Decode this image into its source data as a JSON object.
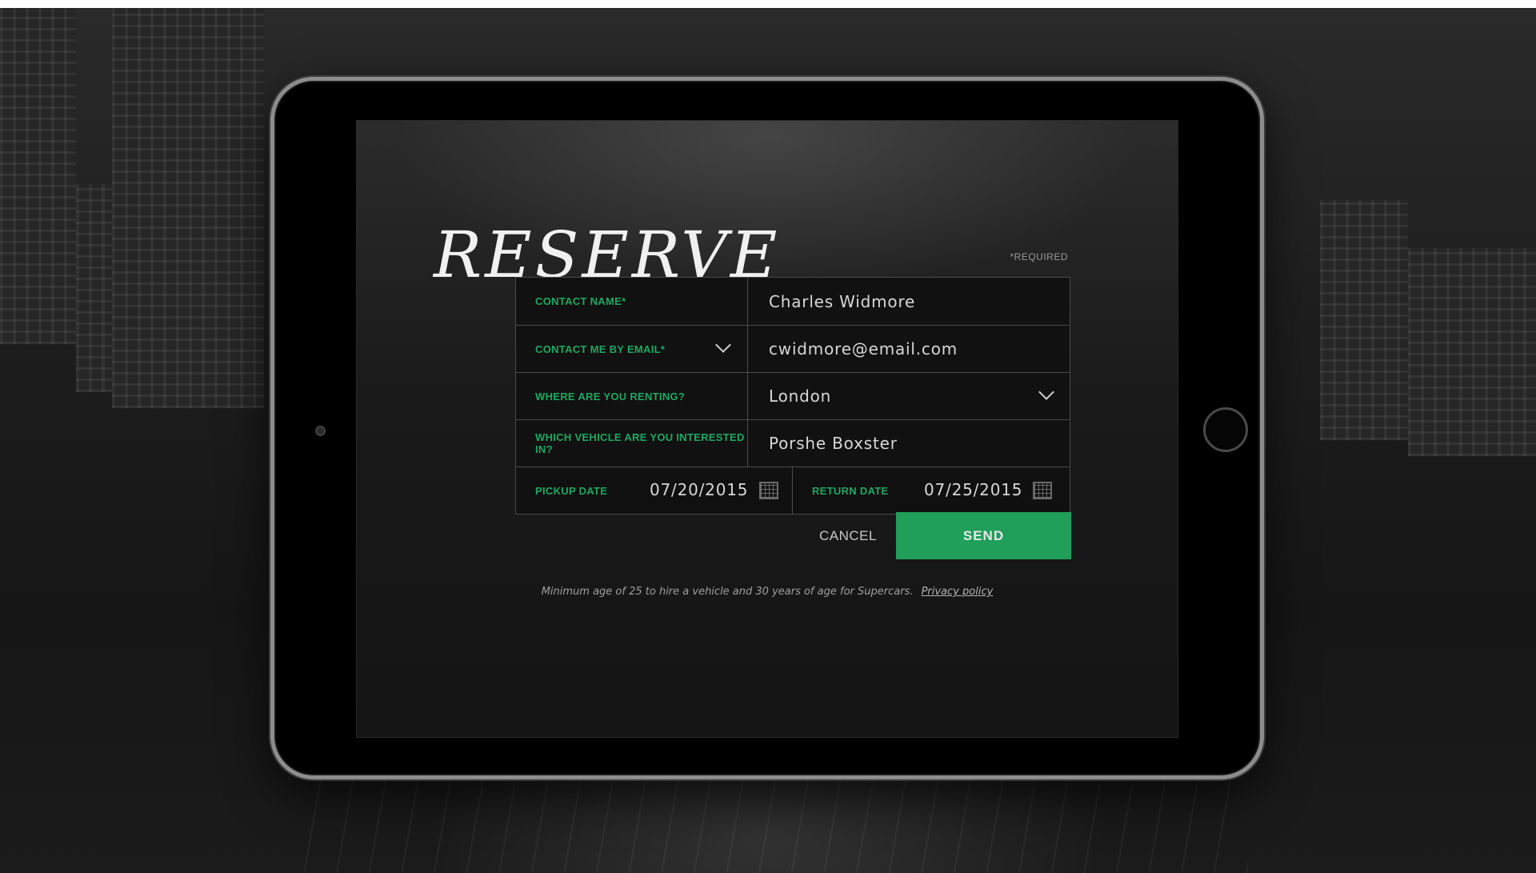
{
  "form": {
    "title": "RESERVE",
    "required_note": "*REQUIRED",
    "fields": {
      "contact_name": {
        "label": "CONTACT NAME*",
        "value": "Charles Widmore"
      },
      "contact_email": {
        "label": "CONTACT ME BY EMAIL*",
        "value": "cwidmore@email.com"
      },
      "renting_location": {
        "label": "WHERE ARE YOU RENTING?",
        "value": "London"
      },
      "vehicle": {
        "label": "WHICH VEHICLE ARE YOU INTERESTED IN?",
        "value": "Porshe Boxster"
      },
      "pickup_date": {
        "label": "PICKUP DATE",
        "value": "07/20/2015"
      },
      "return_date": {
        "label": "RETURN DATE",
        "value": "07/25/2015"
      }
    },
    "buttons": {
      "cancel": "CANCEL",
      "send": "SEND"
    },
    "footnote": {
      "text": "Minimum age of 25 to hire a vehicle and 30 years of age for Supercars.",
      "privacy_link": "Privacy policy"
    }
  },
  "icons": {
    "dropdown": "chevron-down-icon",
    "calendar": "calendar-icon"
  },
  "colors": {
    "accent_green": "#1f9f5a",
    "label_green": "#1fa862",
    "field_border": "#4a4a4a",
    "background": "#141414"
  }
}
